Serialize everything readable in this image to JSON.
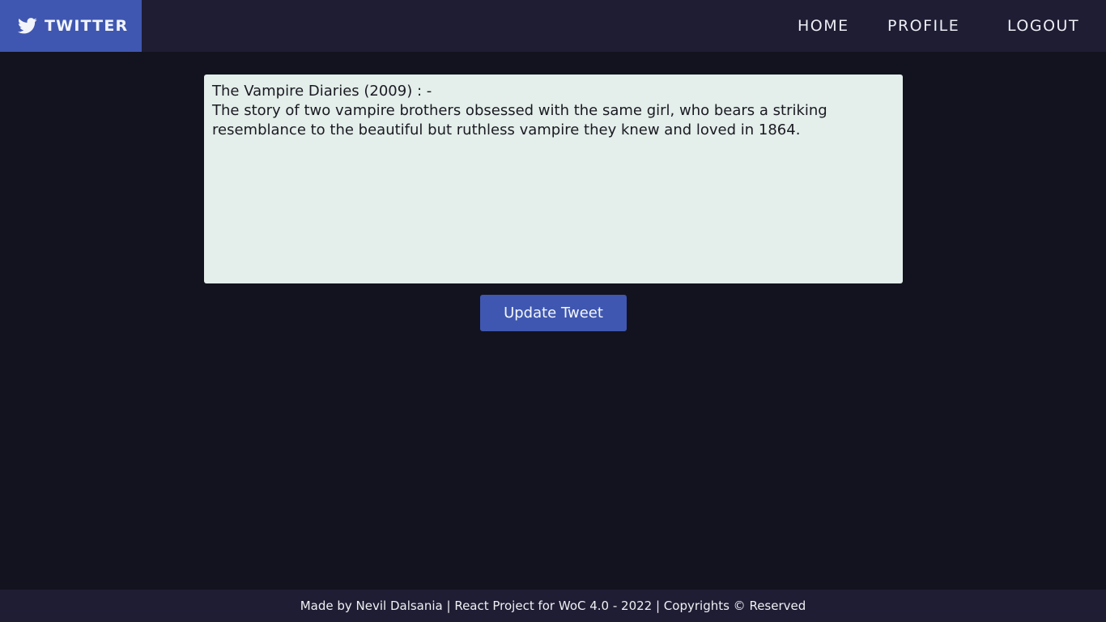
{
  "navbar": {
    "brand_label": "TWITTER",
    "brand_icon": "twitter-bird-icon",
    "links": [
      {
        "label": "HOME"
      },
      {
        "label": "PROFILE"
      },
      {
        "label": "LOGOUT"
      }
    ]
  },
  "editor": {
    "value": "The Vampire Diaries (2009) : -\nThe story of two vampire brothers obsessed with the same girl, who bears a striking resemblance to the beautiful but ruthless vampire they knew and loved in 1864."
  },
  "actions": {
    "update_label": "Update Tweet"
  },
  "footer": {
    "text": "Made by Nevil Dalsania | React Project for WoC 4.0 - 2022 | Copyrights © Reserved"
  },
  "colors": {
    "accent": "#3f57b0",
    "navbar_bg": "#1e1d33",
    "page_bg": "#13131f",
    "editor_bg": "#e4eeea"
  }
}
